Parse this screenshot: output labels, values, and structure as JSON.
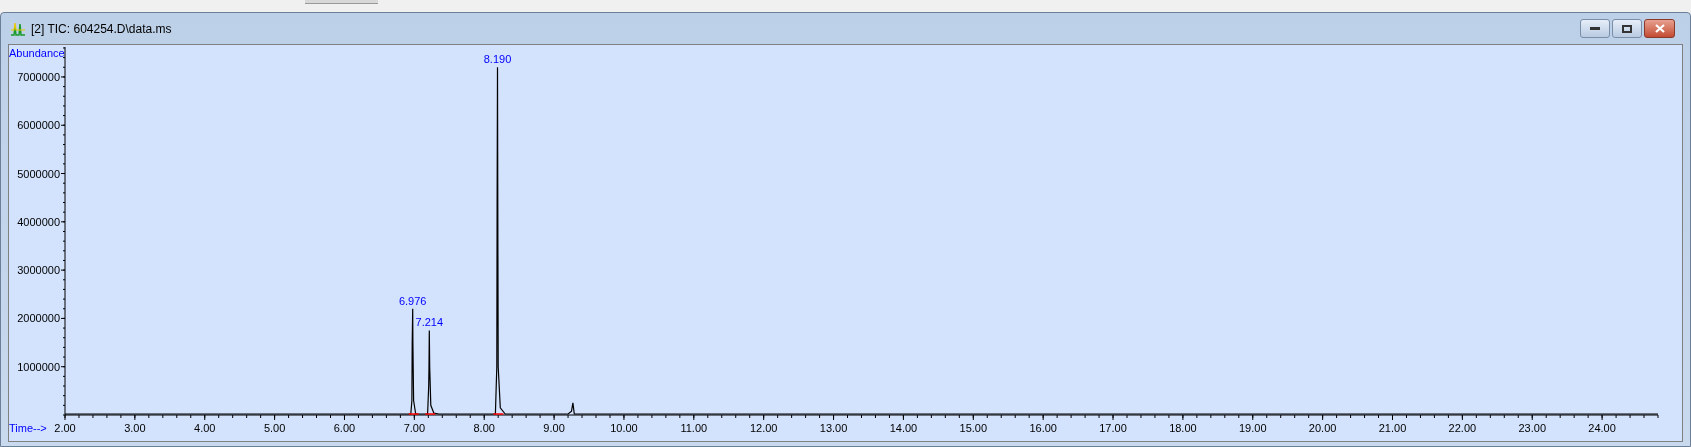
{
  "window": {
    "title": "[2] TIC: 604254.D\\data.ms"
  },
  "chart_data": {
    "type": "line",
    "xlabel": "Time-->",
    "ylabel": "Abundance",
    "xlim": [
      2,
      24.8
    ],
    "ylim": [
      0,
      7620000
    ],
    "x": [
      2.0,
      6.95,
      6.965,
      6.97,
      6.976,
      6.98,
      6.99,
      7.02,
      7.19,
      7.205,
      7.21,
      7.214,
      7.22,
      7.235,
      7.28,
      7.35,
      8.16,
      8.18,
      8.185,
      8.19,
      8.195,
      8.2,
      8.23,
      8.3,
      9.2,
      9.25,
      9.27,
      9.29,
      24.8
    ],
    "series": [
      {
        "color": "#000000",
        "values": [
          20000,
          20000,
          300000,
          1500000,
          2200000,
          1500000,
          300000,
          20000,
          20000,
          600000,
          1000000,
          1750000,
          1000000,
          200000,
          40000,
          20000,
          20000,
          1000000,
          4300000,
          7200000,
          4300000,
          1000000,
          150000,
          20000,
          20000,
          80000,
          250000,
          20000,
          20000
        ]
      }
    ],
    "xticks": [
      {
        "value": 2,
        "label": "2.00"
      },
      {
        "value": 3,
        "label": "3.00"
      },
      {
        "value": 4,
        "label": "4.00"
      },
      {
        "value": 5,
        "label": "5.00"
      },
      {
        "value": 6,
        "label": "6.00"
      },
      {
        "value": 7,
        "label": "7.00"
      },
      {
        "value": 8,
        "label": "8.00"
      },
      {
        "value": 9,
        "label": "9.00"
      },
      {
        "value": 10,
        "label": "10.00"
      },
      {
        "value": 11,
        "label": "11.00"
      },
      {
        "value": 12,
        "label": "12.00"
      },
      {
        "value": 13,
        "label": "13.00"
      },
      {
        "value": 14,
        "label": "14.00"
      },
      {
        "value": 15,
        "label": "15.00"
      },
      {
        "value": 16,
        "label": "16.00"
      },
      {
        "value": 17,
        "label": "17.00"
      },
      {
        "value": 18,
        "label": "18.00"
      },
      {
        "value": 19,
        "label": "19.00"
      },
      {
        "value": 20,
        "label": "20.00"
      },
      {
        "value": 21,
        "label": "21.00"
      },
      {
        "value": 22,
        "label": "22.00"
      },
      {
        "value": 23,
        "label": "23.00"
      },
      {
        "value": 24,
        "label": "24.00"
      }
    ],
    "yticks": [
      1000000,
      2000000,
      3000000,
      4000000,
      5000000,
      6000000,
      7000000
    ],
    "annotations": [
      {
        "x": 6.976,
        "y": 2200000,
        "text": "6.976"
      },
      {
        "x": 7.214,
        "y": 1750000,
        "text": "7.214"
      },
      {
        "x": 8.19,
        "y": 7200000,
        "text": "8.190"
      }
    ]
  }
}
